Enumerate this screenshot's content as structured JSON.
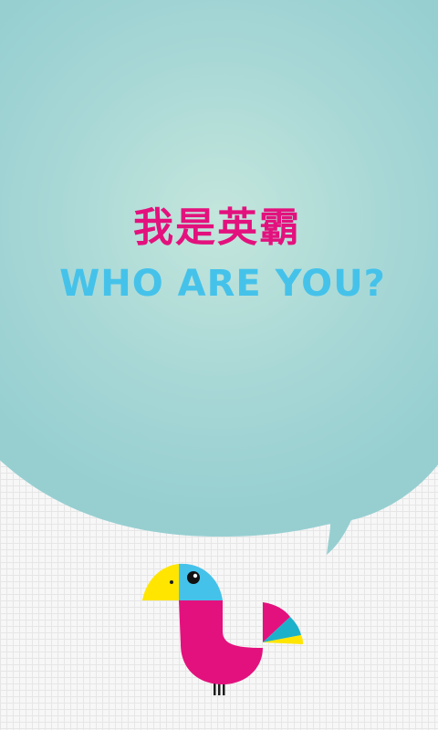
{
  "splash": {
    "title_cn": "我是英霸",
    "title_en": "WHO ARE YOU?"
  },
  "colors": {
    "bubble": "#9dd1d1",
    "bubble_center": "#c4e6dc",
    "title_cn": "#e3117d",
    "title_en": "#45c2ea",
    "bird_body": "#e3117d",
    "bird_beak": "#ffe500",
    "bird_head": "#45c2ea"
  },
  "icons": [
    "speech-bubble",
    "bird-mascot-icon"
  ]
}
